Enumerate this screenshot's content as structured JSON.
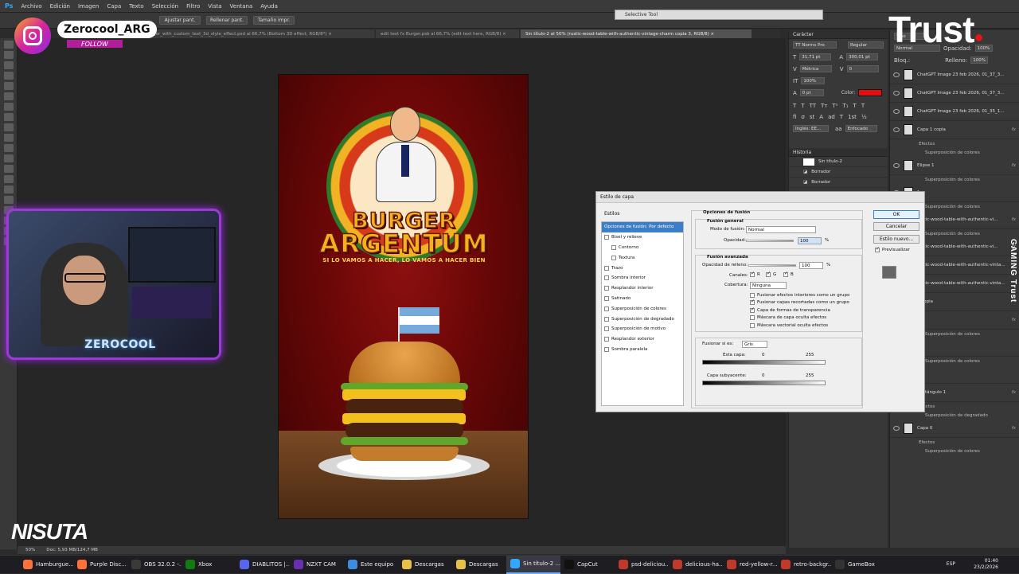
{
  "menubar": {
    "logo": "Ps",
    "items": [
      "Archivo",
      "Edición",
      "Imagen",
      "Capa",
      "Texto",
      "Selección",
      "Filtro",
      "Vista",
      "Ventana",
      "Ayuda"
    ]
  },
  "optionsbar": {
    "buttons": [
      "Ajustar pant.",
      "Rellenar pant.",
      "Tamaño impr."
    ]
  },
  "tabs": [
    {
      "label": "delicious_burger_with_custom_text_3d_style_effect.psd al 66,7% (Bottom 3D effect, RGB/8*) ×"
    },
    {
      "label": "edit text fx Burger.psb al 66,7% (edit text here, RGB/8) ×"
    },
    {
      "label": "Sin título-2 al 50% (rustic-wood-table-with-authentic-vintage-charm copia 3, RGB/8) ×",
      "active": true
    }
  ],
  "selective_tool": "Selective Tool",
  "poster": {
    "title_line1": "BURGER",
    "title_line2": "ARGENTUM",
    "slogan": "SI LO VAMOS A HACER, LO VAMOS A HACER BIEN"
  },
  "character_panel": {
    "header": "Carácter",
    "font": "TT Norms Pro",
    "style": "Regular",
    "size": "31,71 pt",
    "leading": "300,01 pt",
    "kerning": "Métrica",
    "tracking": "0",
    "vscale": "100%",
    "hscale": "100%",
    "baseline": "0 pt",
    "color_label": "Color:",
    "color": "#e01010",
    "lang": "Inglés: EE...",
    "aa": "Enfocado"
  },
  "history_panel": {
    "header": "Historia",
    "snapshot": "Sin título-2",
    "items": [
      "Borrador",
      "Borrador"
    ]
  },
  "layers_panel": {
    "kind": "Tipo",
    "blend": "Normal",
    "opacity_label": "Opacidad:",
    "opacity": "100%",
    "lock_label": "Bloq.:",
    "fill_label": "Relleno:",
    "fill": "100%",
    "layers": [
      {
        "name": "ChatGPT Image 23 feb 2026, 01_37_3..."
      },
      {
        "name": "ChatGPT Image 23 feb 2026, 01_37_3..."
      },
      {
        "name": "ChatGPT Image 23 feb 2026, 01_35_1..."
      },
      {
        "name": "Capa 1 copia",
        "fx": "fx",
        "effects": [
          "Efectos",
          "Superposición de colores"
        ]
      },
      {
        "name": "Elipse 1",
        "fx": "fx",
        "effects": [
          "Superposición de colores"
        ]
      },
      {
        "name": "1",
        "fx": "",
        "effects": [
          "Superposición de colores"
        ]
      },
      {
        "name": "rustic-wood-table-with-authentic-vi...",
        "fx": "fx",
        "effects": [
          "Superposición de colores"
        ]
      },
      {
        "name": "rustic-wood-table-with-authentic-vi...",
        "fx": "fx",
        "effects": []
      },
      {
        "name": "rustic-wood-table-with-authentic-vinta...",
        "fx": "",
        "effects": []
      },
      {
        "name": "rustic-wood-table-with-authentic-vinta...",
        "fx": "",
        "effects": []
      },
      {
        "name": "3 copia",
        "fx": "",
        "effects": []
      },
      {
        "name": "3",
        "fx": "fx",
        "effects": [
          "Superposición de colores"
        ]
      },
      {
        "name": "1",
        "fx": "",
        "effects": [
          "Superposición de colores"
        ]
      },
      {
        "name": "2",
        "fx": "",
        "effects": []
      },
      {
        "name": "Rectángulo 1",
        "fx": "fx",
        "effects": [
          "Efectos",
          "Superposición de degradado"
        ]
      },
      {
        "name": "Capa 0",
        "fx": "fx",
        "effects": [
          "Efectos",
          "Superposición de colores"
        ]
      }
    ]
  },
  "dialog": {
    "title": "Estilo de capa",
    "styles_header": "Estilos",
    "styles": [
      {
        "label": "Opciones de fusión: Por defecto",
        "selected": true,
        "cb": false
      },
      {
        "label": "Bisel y relieve",
        "cb": true
      },
      {
        "label": "Contorno",
        "cb": true,
        "indent": true
      },
      {
        "label": "Textura",
        "cb": true,
        "indent": true
      },
      {
        "label": "Trazo",
        "cb": true
      },
      {
        "label": "Sombra interior",
        "cb": true
      },
      {
        "label": "Resplandor interior",
        "cb": true
      },
      {
        "label": "Satinado",
        "cb": true
      },
      {
        "label": "Superposición de colores",
        "cb": true
      },
      {
        "label": "Superposición de degradado",
        "cb": true
      },
      {
        "label": "Superposición de motivo",
        "cb": true
      },
      {
        "label": "Resplandor exterior",
        "cb": true
      },
      {
        "label": "Sombra paralela",
        "cb": true
      }
    ],
    "blend_options": "Opciones de fusión",
    "general": "Fusión general",
    "mode_label": "Modo de fusión:",
    "mode_value": "Normal",
    "opacity_label": "Opacidad:",
    "opacity_value": "100",
    "pct": "%",
    "advanced": "Fusión avanzada",
    "fill_label": "Opacidad de relleno:",
    "fill_value": "100",
    "channels_label": "Canales:",
    "ch_r": "R",
    "ch_g": "G",
    "ch_b": "B",
    "knockout_label": "Cobertura:",
    "knockout_value": "Ninguna",
    "checks": [
      {
        "label": "Fusionar efectos interiores como un grupo",
        "on": false
      },
      {
        "label": "Fusionar capas recortadas como un grupo",
        "on": true
      },
      {
        "label": "Capa de formas de transparencia",
        "on": true
      },
      {
        "label": "Máscara de capa oculta efectos",
        "on": false
      },
      {
        "label": "Máscara vectorial oculta efectos",
        "on": false
      }
    ],
    "blendif_label": "Fusionar si es:",
    "blendif_value": "Gris",
    "this_layer": "Esta capa:",
    "underlying": "Capa subyacente:",
    "v0": "0",
    "v255": "255",
    "ok": "OK",
    "cancel": "Cancelar",
    "new_style": "Estilo nuevo...",
    "preview": "Previsualizar"
  },
  "overlay": {
    "ig_name": "Zerocool_ARG",
    "ig_follow": "FOLLOW",
    "cam_name": "ZEROCOOL",
    "trust": "Trust",
    "gaming_trust": "GAMING Trust",
    "nisuta": "NISUTA"
  },
  "statusbar": {
    "zoom": "50%",
    "doc": "Doc: 5,93 MB/124,7 MB"
  },
  "taskbar": {
    "items": [
      {
        "label": "Hamburgue...",
        "color": "#ff7139"
      },
      {
        "label": "Purple Disc...",
        "color": "#ff7139"
      },
      {
        "label": "OBS 32.0.2 -...",
        "color": "#3a3a3a"
      },
      {
        "label": "Xbox",
        "color": "#107c10"
      },
      {
        "label": "DIABLITOS |...",
        "color": "#5865f2"
      },
      {
        "label": "NZXT CAM",
        "color": "#6a2fb0"
      },
      {
        "label": "Este equipo",
        "color": "#3a8de0"
      },
      {
        "label": "Descargas",
        "color": "#e8c045"
      },
      {
        "label": "Descargas",
        "color": "#e8c045"
      },
      {
        "label": "Sin título-2 ...",
        "color": "#31a8ff",
        "active": true
      },
      {
        "label": "CapCut",
        "color": "#111"
      },
      {
        "label": "psd-deliciou...",
        "color": "#c0392b"
      },
      {
        "label": "delicious-ha...",
        "color": "#c0392b"
      },
      {
        "label": "red-yellow-r...",
        "color": "#c0392b"
      },
      {
        "label": "retro-backgr...",
        "color": "#c0392b"
      },
      {
        "label": "GameBox",
        "color": "#333"
      }
    ],
    "lang": "ESP",
    "time": "01:40",
    "date": "23/2/2026"
  }
}
